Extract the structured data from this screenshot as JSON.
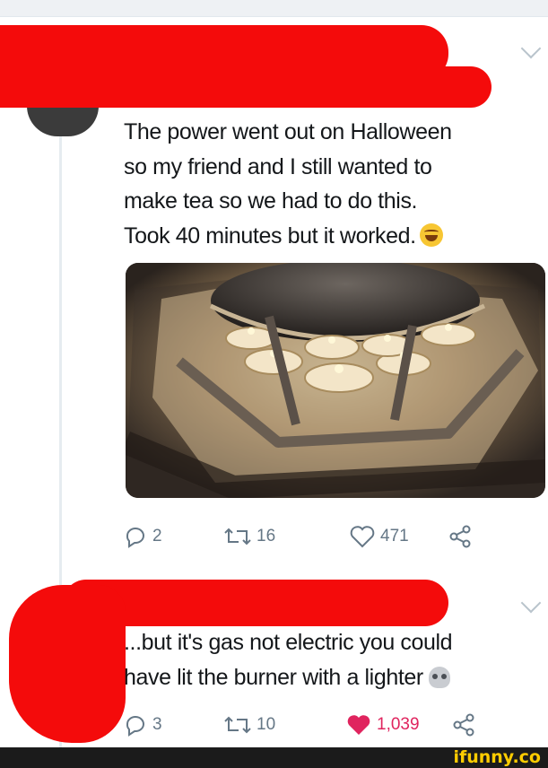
{
  "tweet1": {
    "text": "The power went out on Halloween\nso my friend and I still wanted to\nmake tea so we had to do this.\nTook 40 minutes but it worked.",
    "emoji": "grinning-sweat-emoji",
    "replies": "2",
    "retweets": "16",
    "likes": "471"
  },
  "tweet2": {
    "text": "...but it's gas not electric you could\nhave lit the burner with a lighter",
    "emoji": "skull-emoji",
    "replies": "3",
    "retweets": "10",
    "likes": "1,039",
    "liked": true
  },
  "watermark": "ifunny.co",
  "colors": {
    "redaction": "#f40b0b",
    "like_active": "#e0245e",
    "icon_gray": "#657786",
    "watermark": "#ffcc00"
  }
}
